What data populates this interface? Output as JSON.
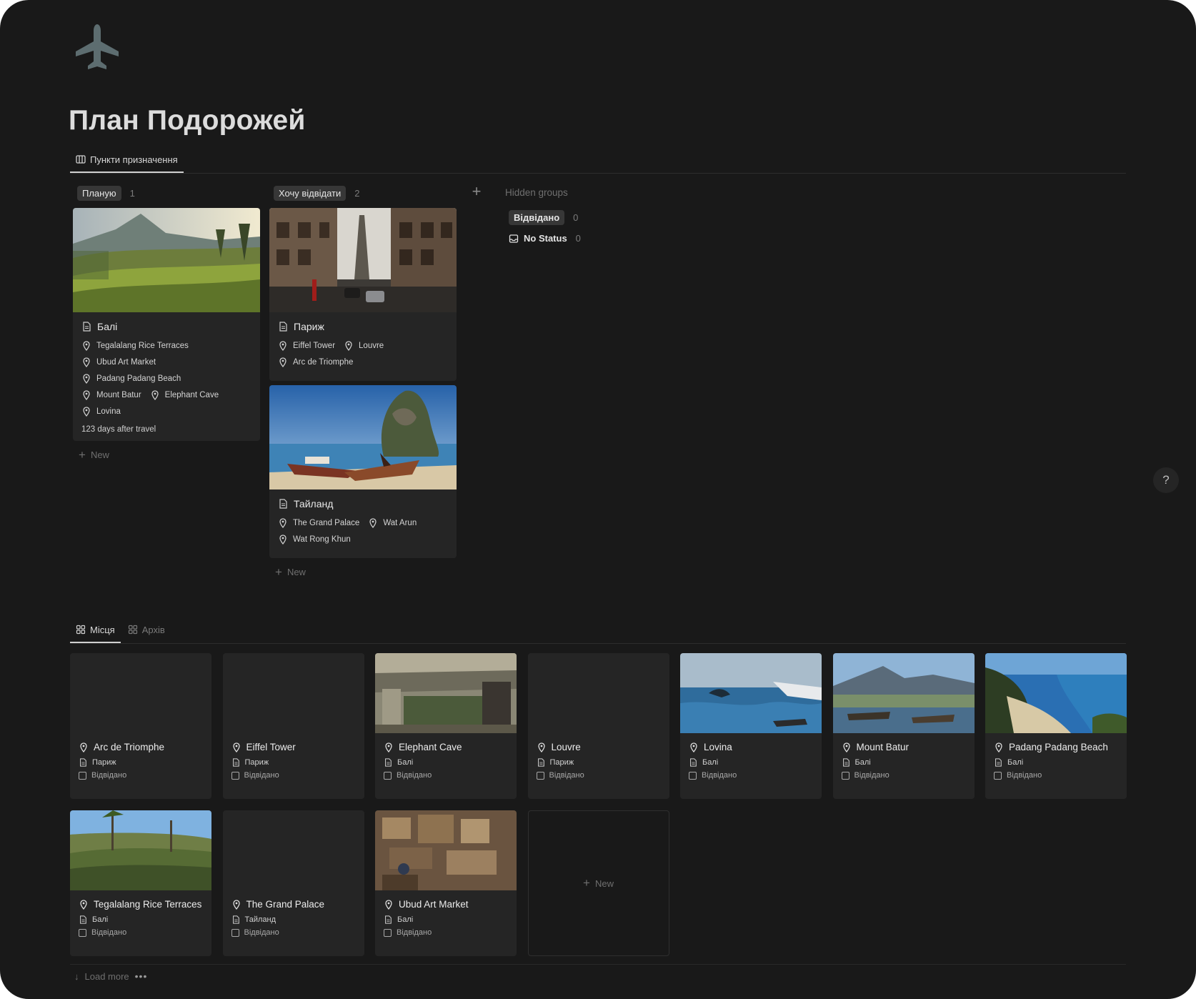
{
  "page": {
    "title": "План Подорожей",
    "icon": "airplane-icon",
    "accent": "#5d6d70"
  },
  "top_tabs": [
    {
      "label": "Пункти призначення",
      "icon": "board-icon"
    }
  ],
  "board": {
    "columns": [
      {
        "label": "Планую",
        "count": "1"
      },
      {
        "label": "Хочу відвідати",
        "count": "2"
      }
    ],
    "new_label": "New",
    "add_group_icon": "plus-icon",
    "hidden_groups_label": "Hidden groups",
    "hidden_groups": [
      {
        "label": "Відвідано",
        "count": "0"
      },
      {
        "label": "No Status",
        "count": "0"
      }
    ],
    "cards": [
      {
        "title": "Балі",
        "places": [
          "Tegalalang Rice Terraces",
          "Ubud Art Market",
          "Padang Padang Beach",
          "Mount Batur",
          "Elephant Cave",
          "Lovina"
        ],
        "footer": "123 days after travel"
      },
      {
        "title": "Париж",
        "places": [
          "Eiffel Tower",
          "Louvre",
          "Arc de Triomphe"
        ]
      },
      {
        "title": "Тайланд",
        "places": [
          "The Grand Palace",
          "Wat Arun",
          "Wat Rong Khun"
        ]
      }
    ]
  },
  "bottom_tabs": [
    {
      "label": "Місця",
      "icon": "gallery-icon"
    },
    {
      "label": "Архів",
      "icon": "gallery-icon"
    }
  ],
  "gallery": {
    "status_label": "Відвідано",
    "items": [
      {
        "name": "Arc de Triomphe",
        "destination": "Париж"
      },
      {
        "name": "Eiffel Tower",
        "destination": "Париж"
      },
      {
        "name": "Elephant Cave",
        "destination": "Балі"
      },
      {
        "name": "Louvre",
        "destination": "Париж"
      },
      {
        "name": "Lovina",
        "destination": "Балі"
      },
      {
        "name": "Mount Batur",
        "destination": "Балі"
      },
      {
        "name": "Padang Padang Beach",
        "destination": "Балі"
      },
      {
        "name": "Tegalalang Rice Terraces",
        "destination": "Балі"
      },
      {
        "name": "The Grand Palace",
        "destination": "Тайланд"
      },
      {
        "name": "Ubud Art Market",
        "destination": "Балі"
      }
    ],
    "new_label": "New",
    "load_more_label": "Load more",
    "more_label": "•••"
  },
  "help_label": "?"
}
